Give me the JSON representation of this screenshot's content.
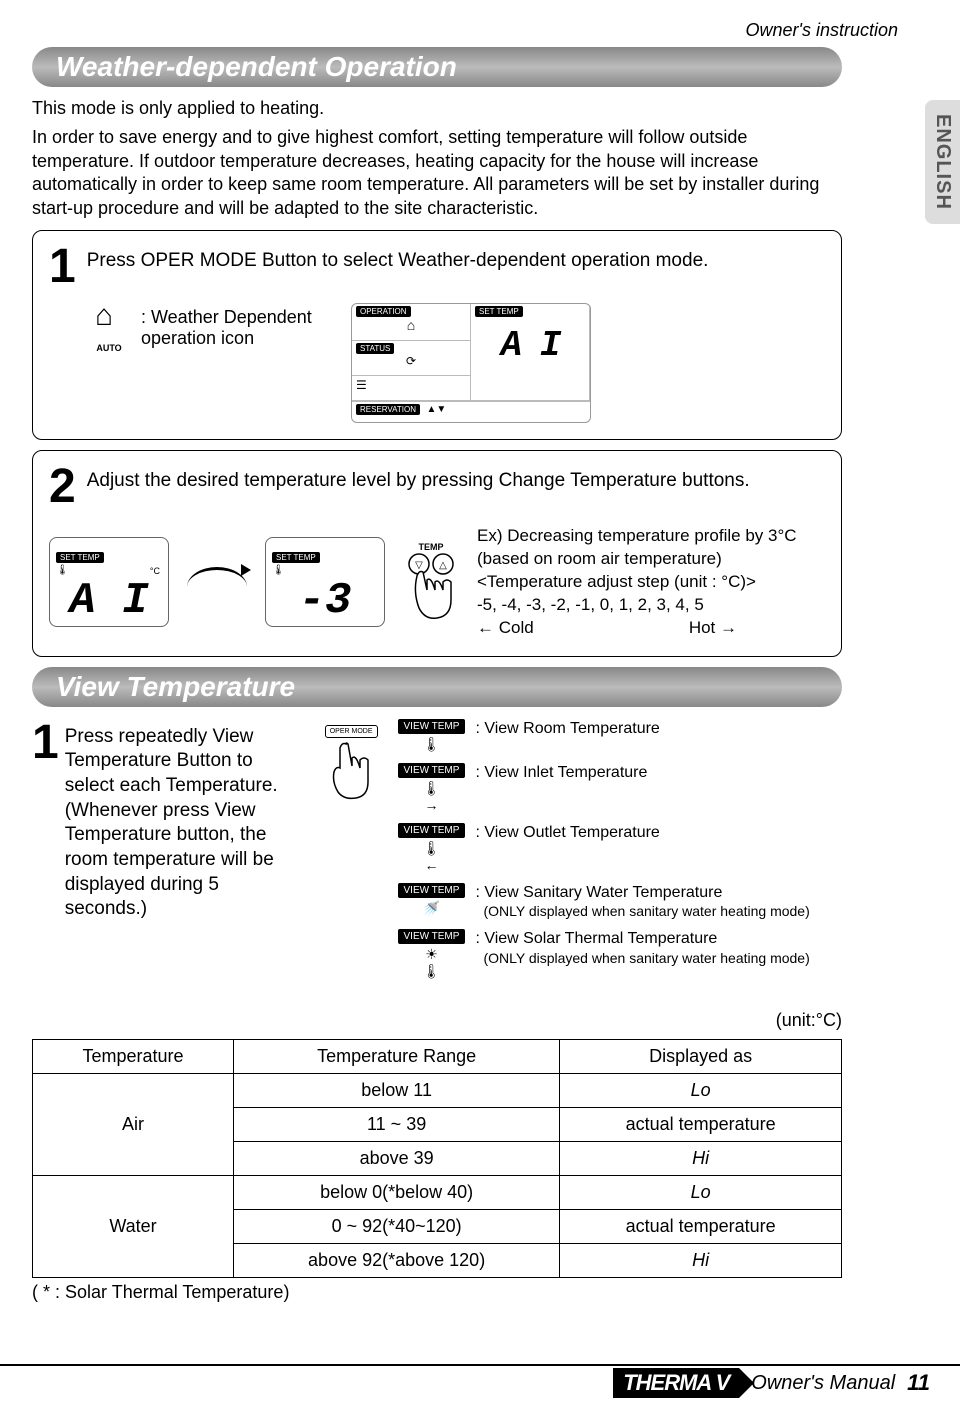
{
  "header_text": "Owner's instruction",
  "english_tab": "ENGLISH",
  "section1": {
    "title": "Weather-dependent Operation",
    "intro1": "This mode is only applied to heating.",
    "intro2": "In order to save energy and to give highest comfort, setting temperature  will follow outside temperature. If outdoor temperature decreases, heating  capacity for the house will increase automatically in order to keep  same room temperature. All parameters will be set by installer during start-up procedure and will be adapted to the site characteristic."
  },
  "step1": {
    "num": "1",
    "text": "Press OPER MODE Button to select Weather-dependent operation mode.",
    "icon_label": ": Weather Dependent operation icon",
    "auto": "AUTO",
    "lcd": {
      "operation": "OPERATION",
      "status": "STATUS",
      "set_temp": "SET TEMP",
      "reservation": "RESERVATION",
      "value": "A I"
    }
  },
  "step2": {
    "num": "2",
    "text": "Adjust the desired temperature level by pressing Change Temperature buttons.",
    "set_temp": "SET TEMP",
    "val1": "A I",
    "degC": "°C",
    "val2": "-3",
    "temp_lbl": "TEMP",
    "explain1": "Ex) Decreasing temperature profile by 3°C",
    "explain2": "(based on room air temperature)",
    "explain3": "<Temperature adjust step (unit : °C)>",
    "explain4": "-5, -4, -3, -2, -1, 0, 1, 2, 3, 4, 5",
    "cold": "← Cold",
    "hot": "Hot →"
  },
  "section2": {
    "title": "View Temperature"
  },
  "view1": {
    "num": "1",
    "text": "Press repeatedly View Temperature Button to select each Temperature. (Whenever press View Temperature button, the room temperature will be displayed during 5 seconds.)",
    "oper_mode": "OPER MODE",
    "view_temp": "VIEW TEMP",
    "items": [
      {
        "label": ": View Room Temperature",
        "sub": ""
      },
      {
        "label": ": View Inlet Temperature",
        "sub": ""
      },
      {
        "label": ": View Outlet Temperature",
        "sub": ""
      },
      {
        "label": ": View Sanitary Water Temperature",
        "sub": "(ONLY displayed when sanitary water heating mode)"
      },
      {
        "label": ": View Solar Thermal Temperature",
        "sub": "(ONLY displayed when sanitary water heating mode)"
      }
    ]
  },
  "unit": "(unit:°C)",
  "table": {
    "headers": [
      "Temperature",
      "Temperature Range",
      "Displayed as"
    ],
    "rows": [
      {
        "cat": "Air",
        "range": "below 11",
        "disp": "Lo",
        "span": true
      },
      {
        "cat": "",
        "range": "11 ~ 39",
        "disp": "actual temperature"
      },
      {
        "cat": "",
        "range": "above 39",
        "disp": "Hi"
      },
      {
        "cat": "Water",
        "range": "below 0(*below 40)",
        "disp": "Lo",
        "span": true
      },
      {
        "cat": "",
        "range": "0 ~ 92(*40~120)",
        "disp": "actual temperature"
      },
      {
        "cat": "",
        "range": "above 92(*above 120)",
        "disp": "Hi"
      }
    ]
  },
  "footnote": "( * : Solar Thermal Temperature)",
  "footer": {
    "brand": "THERMA V",
    "om": "Owner's Manual",
    "page": "11"
  },
  "chart_data": {
    "type": "table",
    "title": "Temperature display ranges",
    "columns": [
      "Temperature",
      "Temperature Range",
      "Displayed as"
    ],
    "rows": [
      [
        "Air",
        "below 11",
        "Lo"
      ],
      [
        "Air",
        "11 ~ 39",
        "actual temperature"
      ],
      [
        "Air",
        "above 39",
        "Hi"
      ],
      [
        "Water",
        "below 0 (*below 40)",
        "Lo"
      ],
      [
        "Water",
        "0 ~ 92 (*40~120)",
        "actual temperature"
      ],
      [
        "Water",
        "above 92 (*above 120)",
        "Hi"
      ]
    ],
    "unit": "°C",
    "note": "* : Solar Thermal Temperature"
  }
}
